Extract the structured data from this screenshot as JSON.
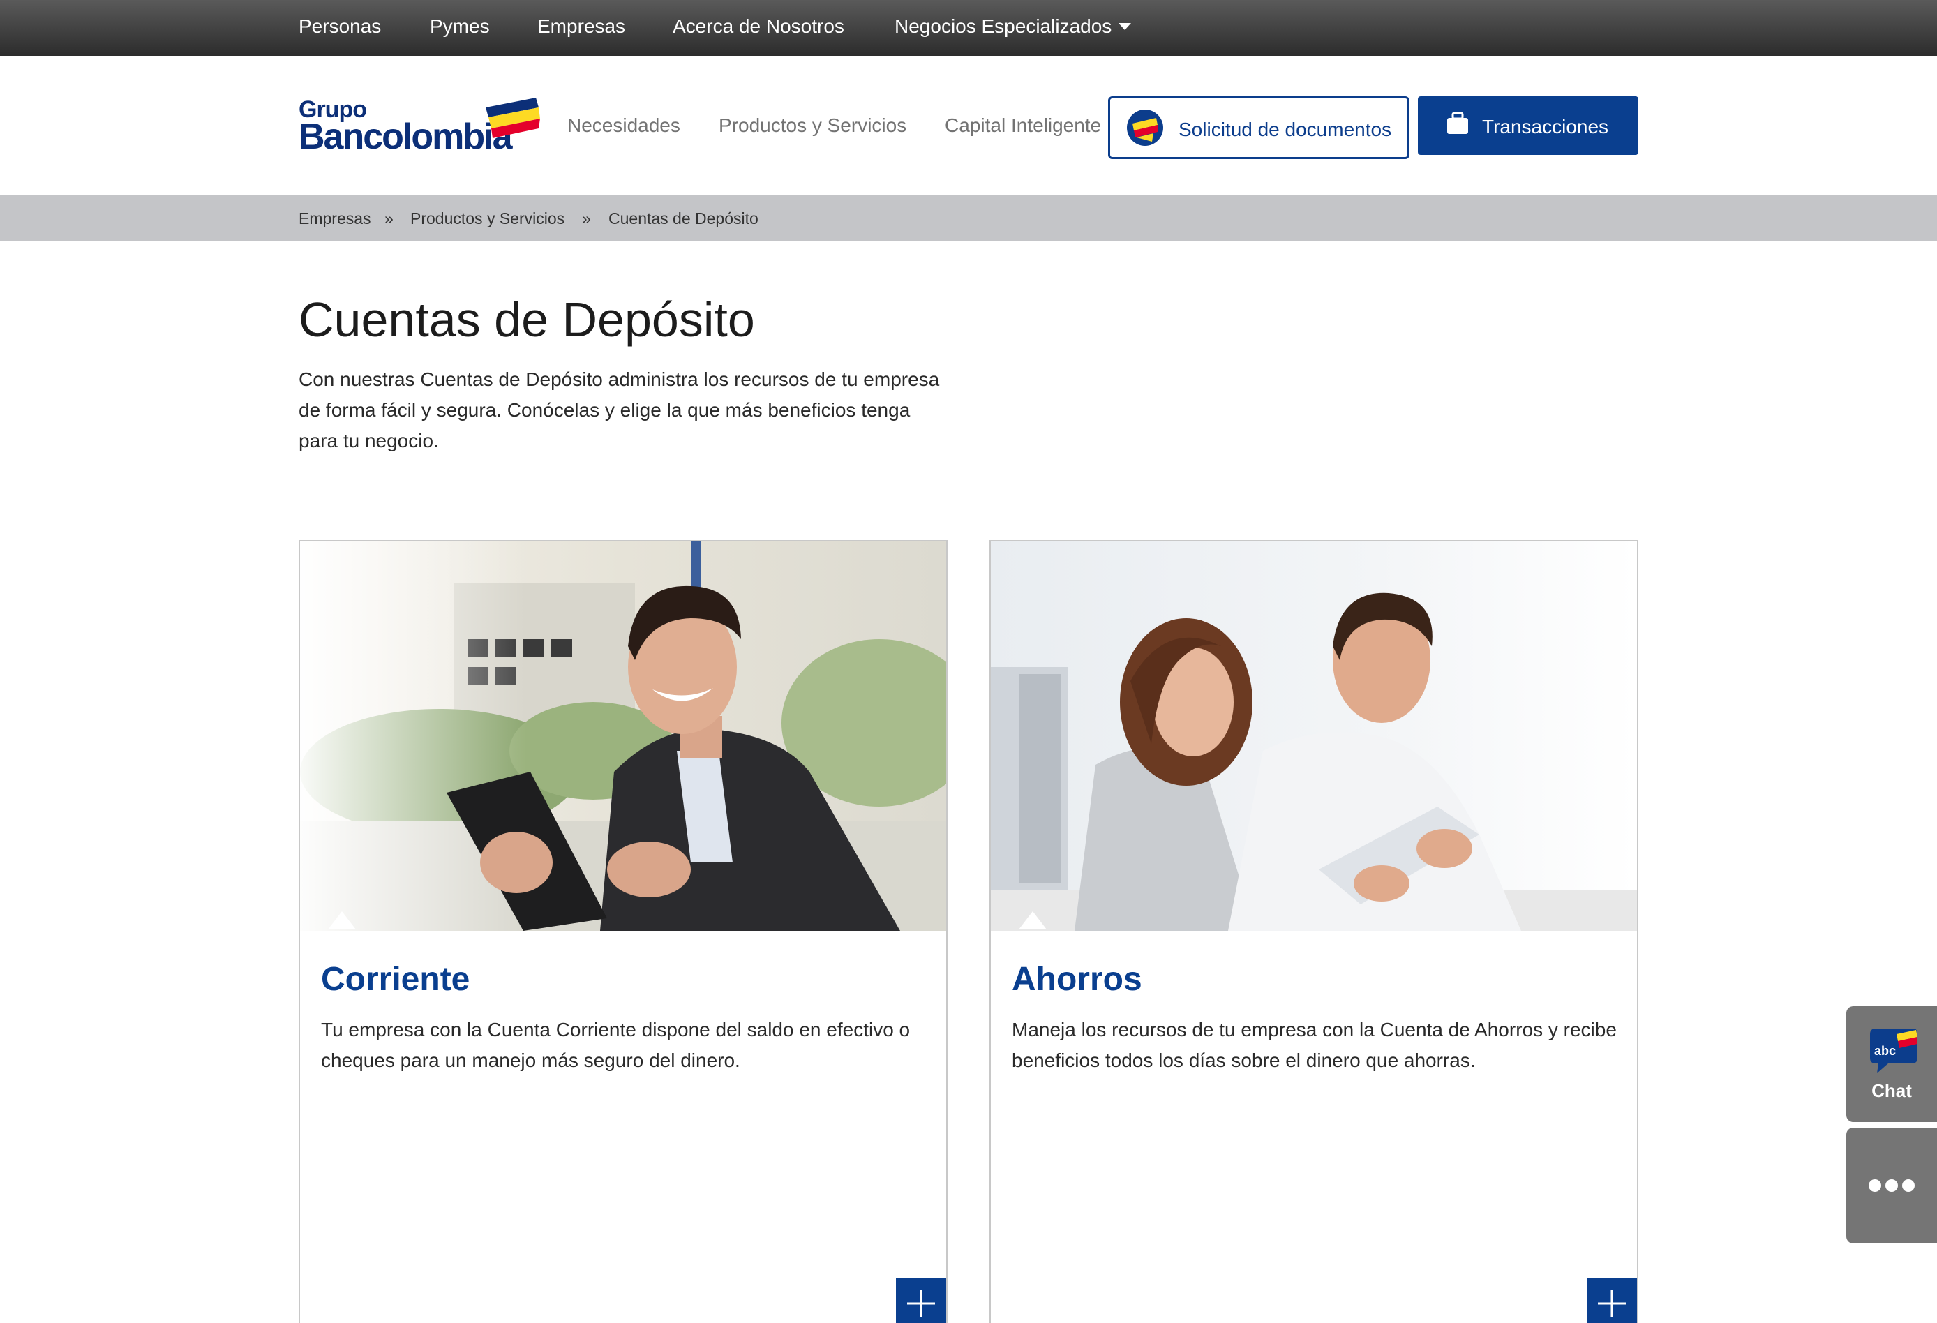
{
  "top_nav": {
    "items": [
      "Personas",
      "Pymes",
      "Empresas",
      "Acerca de Nosotros",
      "Negocios Especializados"
    ]
  },
  "header": {
    "logo_line1": "Grupo",
    "logo_line2": "Bancolombia",
    "nav": [
      "Necesidades",
      "Productos y Servicios",
      "Capital Inteligente"
    ],
    "doc_button": "Solicitud de documentos",
    "tx_button": "Transacciones"
  },
  "breadcrumb": {
    "items": [
      "Empresas",
      "Productos y Servicios",
      "Cuentas de Depósito"
    ],
    "separator": "»"
  },
  "page": {
    "title": "Cuentas de Depósito",
    "intro": "Con nuestras Cuentas de Depósito administra los recursos de tu empresa de forma fácil y segura. Conócelas y elige la que más beneficios tenga para tu negocio."
  },
  "cards": [
    {
      "title": "Corriente",
      "description": "Tu empresa con la Cuenta Corriente dispone del saldo en efectivo o cheques para un manejo más seguro del dinero."
    },
    {
      "title": "Ahorros",
      "description": "Maneja los recursos de tu empresa con la Cuenta de Ahorros y recibe beneficios todos los días sobre el dinero que ahorras."
    }
  ],
  "widgets": {
    "chat_label": "Chat",
    "chat_badge": "abc"
  },
  "colors": {
    "brand_blue": "#0a3f8f",
    "yellow": "#fdda24",
    "red": "#e4002b",
    "breadcrumb_bg": "#c4c5c8"
  },
  "icons": [
    "caret-down-icon",
    "logo-flag-icon",
    "document-request-icon",
    "briefcase-icon",
    "plus-icon",
    "chat-icon",
    "more-dots-icon"
  ]
}
